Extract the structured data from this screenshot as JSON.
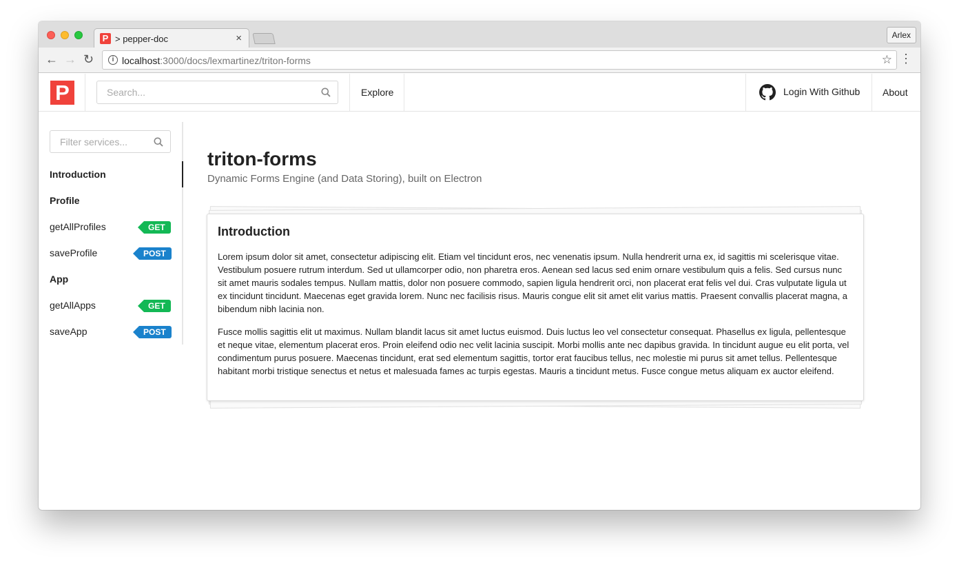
{
  "browser": {
    "tab_title": "> pepper-doc",
    "tab_favicon_letter": "P",
    "tab_close": "×",
    "profile_name": "Arlex",
    "url_host": "localhost",
    "url_rest": ":3000/docs/lexmartinez/triton-forms",
    "back_glyph": "←",
    "forward_glyph": "→",
    "reload_glyph": "↻",
    "star_glyph": "☆",
    "menu_glyph": "⋮",
    "info_glyph": "i"
  },
  "header": {
    "logo_letter": "P",
    "search_placeholder": "Search...",
    "explore_label": "Explore",
    "login_label": "Login With Github",
    "about_label": "About"
  },
  "sidebar": {
    "filter_placeholder": "Filter services...",
    "items": [
      {
        "label": "Introduction",
        "kind": "section",
        "active": true
      },
      {
        "label": "Profile",
        "kind": "section"
      },
      {
        "label": "getAllProfiles",
        "kind": "endpoint",
        "method": "GET"
      },
      {
        "label": "saveProfile",
        "kind": "endpoint",
        "method": "POST"
      },
      {
        "label": "App",
        "kind": "section"
      },
      {
        "label": "getAllApps",
        "kind": "endpoint",
        "method": "GET"
      },
      {
        "label": "saveApp",
        "kind": "endpoint",
        "method": "POST"
      }
    ]
  },
  "main": {
    "title": "triton-forms",
    "subtitle": "Dynamic Forms Engine (and Data Storing), built on Electron",
    "card": {
      "title": "Introduction",
      "paragraphs": [
        "Lorem ipsum dolor sit amet, consectetur adipiscing elit. Etiam vel tincidunt eros, nec venenatis ipsum. Nulla hendrerit urna ex, id sagittis mi scelerisque vitae. Vestibulum posuere rutrum interdum. Sed ut ullamcorper odio, non pharetra eros. Aenean sed lacus sed enim ornare vestibulum quis a felis. Sed cursus nunc sit amet mauris sodales tempus. Nullam mattis, dolor non posuere commodo, sapien ligula hendrerit orci, non placerat erat felis vel dui. Cras vulputate ligula ut ex tincidunt tincidunt. Maecenas eget gravida lorem. Nunc nec facilisis risus. Mauris congue elit sit amet elit varius mattis. Praesent convallis placerat magna, a bibendum nibh lacinia non.",
        "Fusce mollis sagittis elit ut maximus. Nullam blandit lacus sit amet luctus euismod. Duis luctus leo vel consectetur consequat. Phasellus ex ligula, pellentesque et neque vitae, elementum placerat eros. Proin eleifend odio nec velit lacinia suscipit. Morbi mollis ante nec dapibus gravida. In tincidunt augue eu elit porta, vel condimentum purus posuere. Maecenas tincidunt, erat sed elementum sagittis, tortor erat faucibus tellus, nec molestie mi purus sit amet tellus. Pellentesque habitant morbi tristique senectus et netus et malesuada fames ac turpis egestas. Mauris a tincidunt metus. Fusce congue metus aliquam ex auctor eleifend."
      ]
    }
  },
  "colors": {
    "brand": "#f0423b",
    "get_badge": "#13b855",
    "post_badge": "#1a82cc"
  },
  "icons": {
    "search": "search-icon",
    "github": "github-icon",
    "info": "info-icon",
    "star": "star-icon"
  }
}
